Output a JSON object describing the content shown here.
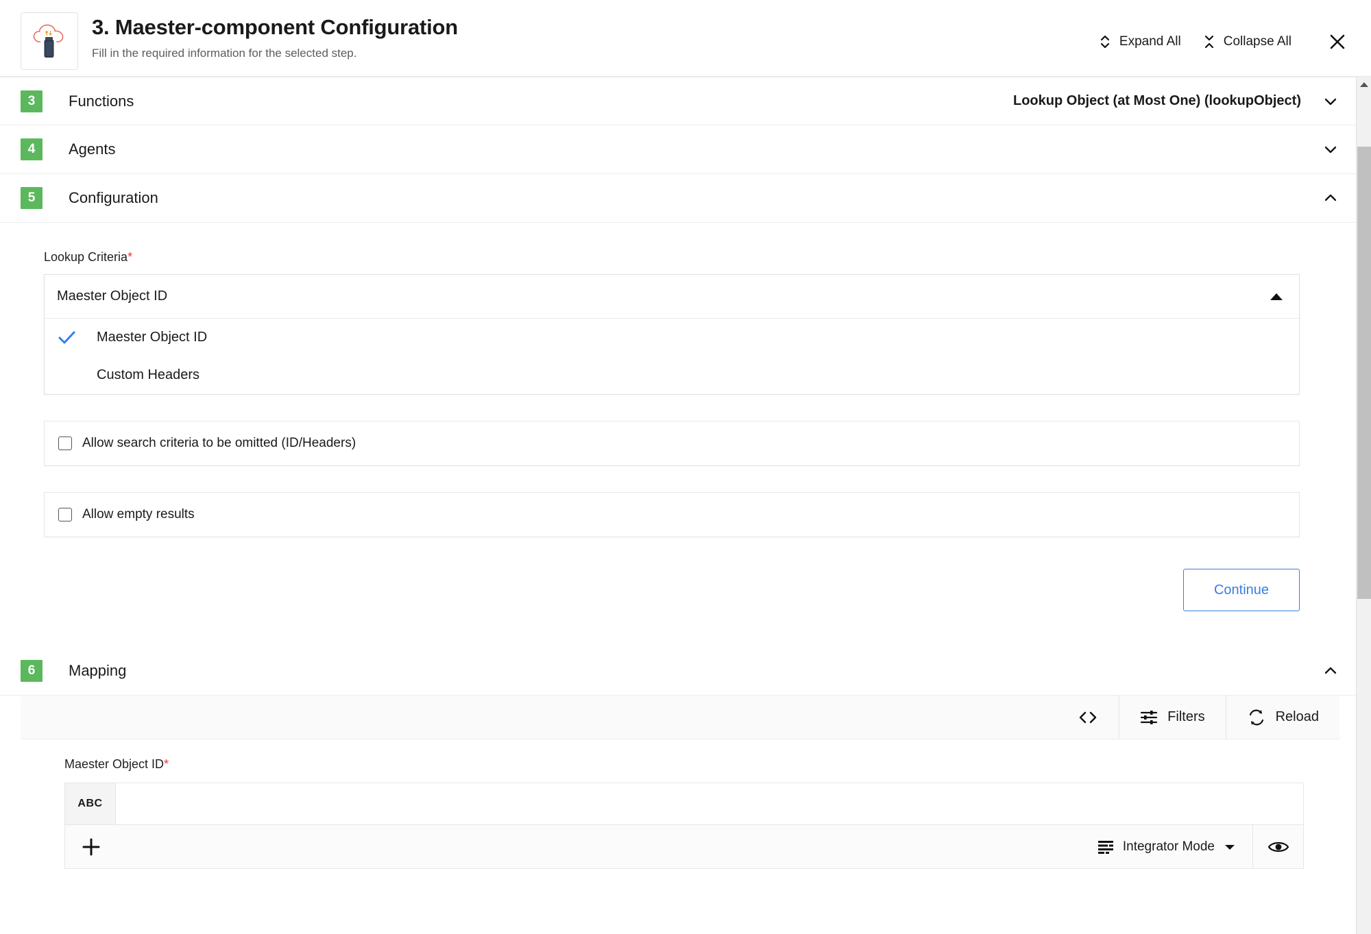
{
  "header": {
    "title": "3. Maester-component Configuration",
    "subtitle": "Fill in the required information for the selected step.",
    "icon": "cloud-usb-icon",
    "expand_all_label": "Expand All",
    "collapse_all_label": "Collapse All",
    "close_label": "Close"
  },
  "accordion": {
    "functions": {
      "number": "3",
      "label": "Functions",
      "value": "Lookup Object (at Most One) (lookupObject)",
      "state": "collapsed"
    },
    "agents": {
      "number": "4",
      "label": "Agents",
      "value": "",
      "state": "collapsed"
    },
    "configuration": {
      "number": "5",
      "label": "Configuration",
      "state": "expanded"
    },
    "mapping": {
      "number": "6",
      "label": "Mapping",
      "state": "expanded"
    }
  },
  "configuration": {
    "lookup_criteria": {
      "label": "Lookup Criteria",
      "required_marker": "*",
      "selected": "Maester Object ID",
      "open": true,
      "options": [
        {
          "label": "Maester Object ID",
          "checked": true
        },
        {
          "label": "Custom Headers",
          "checked": false
        }
      ]
    },
    "checkboxes": [
      {
        "label": "Allow search criteria to be omitted (ID/Headers)",
        "checked": false
      },
      {
        "label": "Allow empty results",
        "checked": false
      }
    ],
    "continue_label": "Continue"
  },
  "mapping": {
    "toolbar": {
      "code_icon": "code-brackets-icon",
      "filters_label": "Filters",
      "filters_icon": "tune-sliders-icon",
      "reload_label": "Reload",
      "reload_icon": "refresh-sync-icon"
    },
    "field": {
      "label": "Maester Object ID",
      "required_marker": "*",
      "type_tag": "ABC",
      "value": "",
      "placeholder": ""
    },
    "footer": {
      "add_label": "+",
      "mode_label": "Integrator Mode",
      "mode_icon": "list-data-icon",
      "preview_icon": "eye-icon"
    }
  },
  "colors": {
    "badge_green": "#5cb85c",
    "accent_blue": "#3b7ddd",
    "required_red": "#e53935",
    "check_blue": "#2f80ed"
  }
}
